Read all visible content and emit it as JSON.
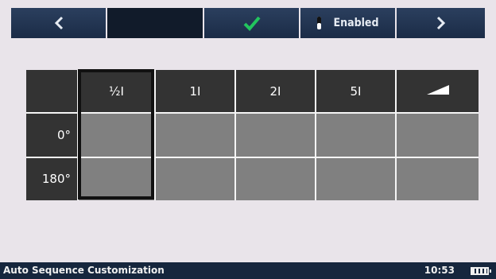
{
  "toolbar": {
    "prev_icon": "chevron-left-icon",
    "check_icon": "checkmark-icon",
    "check_color": "#22c55e",
    "toggle_label": "Enabled",
    "next_icon": "chevron-right-icon"
  },
  "grid": {
    "columns": [
      "½I",
      "1I",
      "2I",
      "5I",
      "ramp-icon"
    ],
    "rows": [
      "0°",
      "180°"
    ],
    "selected_column": "½I"
  },
  "status": {
    "title": "Auto Sequence Customization",
    "time": "10:53",
    "battery_icon": "battery-icon"
  }
}
